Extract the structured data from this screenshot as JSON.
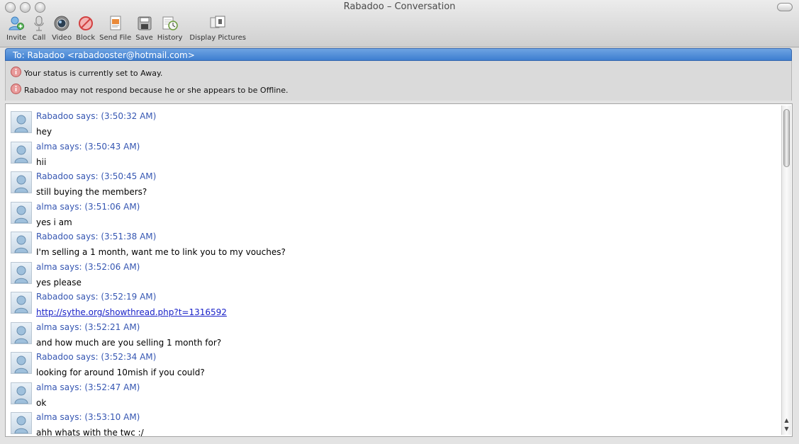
{
  "window": {
    "title": "Rabadoo – Conversation"
  },
  "toolbar": {
    "buttons": [
      {
        "label": "Invite",
        "icon": "invite-icon"
      },
      {
        "label": "Call",
        "icon": "microphone-icon"
      },
      {
        "label": "Video",
        "icon": "webcam-icon"
      },
      {
        "label": "Block",
        "icon": "block-icon"
      },
      {
        "label": "Send File",
        "icon": "send-file-icon"
      },
      {
        "label": "Save",
        "icon": "save-icon"
      },
      {
        "label": "History",
        "icon": "history-icon"
      },
      {
        "label": "Display Pictures",
        "icon": "display-pictures-icon"
      }
    ]
  },
  "to_bar": {
    "text": "To: Rabadoo <rabadooster@hotmail.com>"
  },
  "status_messages": [
    "Your status is currently set to Away.",
    "Rabadoo may not respond because he or she appears to be Offline."
  ],
  "messages": [
    {
      "sender": "Rabadoo says: (3:50:32 AM)",
      "text": "hey"
    },
    {
      "sender": "alma says: (3:50:43 AM)",
      "text": "hii"
    },
    {
      "sender": "Rabadoo says: (3:50:45 AM)",
      "text": "still buying the members?"
    },
    {
      "sender": "alma says: (3:51:06 AM)",
      "text": "yes i am"
    },
    {
      "sender": "Rabadoo says: (3:51:38 AM)",
      "text": "I'm selling a 1 month, want me to link you to my vouches?"
    },
    {
      "sender": "alma says: (3:52:06 AM)",
      "text": "yes please"
    },
    {
      "sender": "Rabadoo says: (3:52:19 AM)",
      "text": "http://sythe.org/showthread.php?t=1316592",
      "is_link": true
    },
    {
      "sender": "alma says: (3:52:21 AM)",
      "text": "and how much are you selling 1 month for?"
    },
    {
      "sender": "Rabadoo says: (3:52:34 AM)",
      "text": "looking for around 10mish if you could?"
    },
    {
      "sender": "alma says: (3:52:47 AM)",
      "text": "ok"
    },
    {
      "sender": "alma says: (3:53:10 AM)",
      "text": "ahh whats with the twc :/"
    }
  ],
  "colors": {
    "sender": "#3556b2",
    "to_bar": "#4a8ad8",
    "link": "#1a22c8"
  }
}
